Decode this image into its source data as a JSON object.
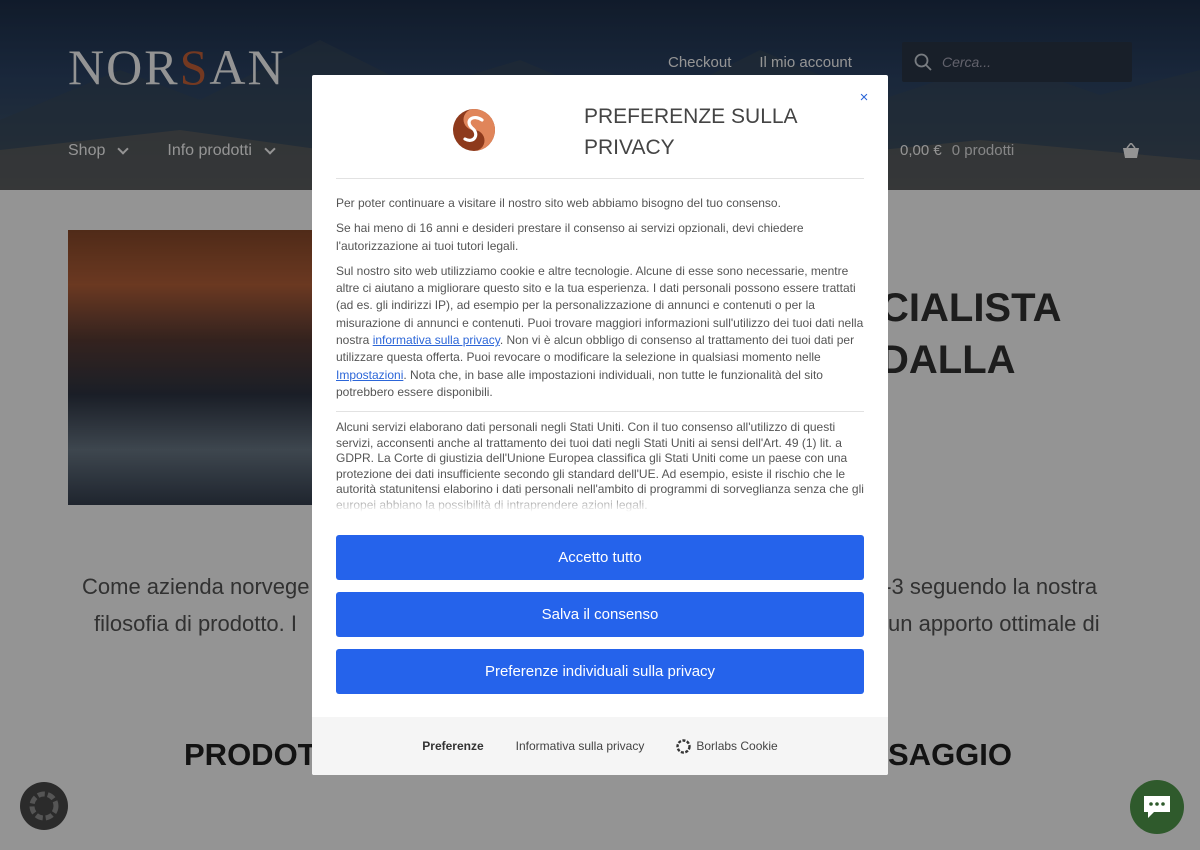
{
  "header": {
    "logo_left": "NOR",
    "logo_s": "S",
    "logo_right": "AN",
    "top_links": [
      "Checkout",
      "Il mio account"
    ],
    "search_placeholder": "Cerca...",
    "nav": [
      {
        "label": "Shop"
      },
      {
        "label": "Info prodotti"
      }
    ],
    "cart_total": "0,00 €",
    "cart_count": "0 prodotti"
  },
  "hero": {
    "title_line1": "CIALISTA",
    "title_line2": "DALLA"
  },
  "body": {
    "line1_left": "Come azienda norvege",
    "line1_right": "a-3 seguendo la nostra",
    "line2_left": "filosofia di prodotto. I",
    "line2_right": "un apporto ottimale di",
    "products_left": "PRODOT",
    "products_right": "SAGGIO"
  },
  "modal": {
    "title": "PREFERENZE SULLA PRIVACY",
    "close_icon": "×",
    "p1": "Per poter continuare a visitare il nostro sito web abbiamo bisogno del tuo consenso.",
    "p2": "Se hai meno di 16 anni e desideri prestare il consenso ai servizi opzionali, devi chiedere l'autorizzazione ai tuoi tutori legali.",
    "p3_a": "Sul nostro sito web utilizziamo cookie e altre tecnologie. Alcune di esse sono necessarie, mentre altre ci aiutano a migliorare questo sito e la tua esperienza. I dati personali possono essere trattati (ad es. gli indirizzi IP), ad esempio per la personalizzazione di annunci e contenuti o per la misurazione di annunci e contenuti. Puoi trovare maggiori informazioni sull'utilizzo dei tuoi dati nella nostra ",
    "p3_link1": "informativa sulla privacy",
    "p3_b": ". Non vi è alcun obbligo di consenso al trattamento dei tuoi dati per utilizzare questa offerta. Puoi revocare o modificare la selezione in qualsiasi momento nelle ",
    "p3_link2": "Impostazioni",
    "p3_c": ". Nota che, in base alle impostazioni individuali, non tutte le funzionalità del sito potrebbero essere disponibili.",
    "p4": "Alcuni servizi elaborano dati personali negli Stati Uniti. Con il tuo consenso all'utilizzo di questi servizi, acconsenti anche al trattamento dei tuoi dati negli Stati Uniti ai sensi dell'Art. 49 (1) lit. a GDPR. La Corte di giustizia dell'Unione Europea classifica gli Stati Uniti come un paese con una protezione dei dati insufficiente secondo gli standard dell'UE. Ad esempio, esiste il rischio che le autorità statunitensi elaborino i dati personali nell'ambito di programmi di sorveglianza senza che gli europei abbiano la possibilità di intraprendere azioni legali.",
    "btn_accept_all": "Accetto tutto",
    "btn_save": "Salva il consenso",
    "btn_individual": "Preferenze individuali sulla privacy",
    "footer_preferences": "Preferenze",
    "footer_privacy": "Informativa sulla privacy",
    "footer_brand": "Borlabs Cookie"
  },
  "colors": {
    "accent": "#2563eb",
    "logo_s": "#c9623a",
    "chat_fab": "#2f5a2c"
  }
}
